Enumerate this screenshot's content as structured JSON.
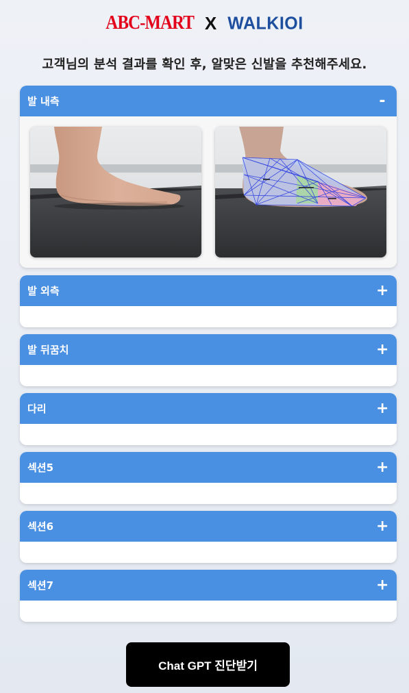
{
  "brand": {
    "abc_mart": "ABC-MART",
    "separator": "X",
    "walk": "WALKIOI"
  },
  "headline": "고객님의 분석 결과를 확인 후, 알맞은 신발을 추천해주세요.",
  "sections": [
    {
      "title": "발 내측",
      "toggle": "-",
      "expanded": true
    },
    {
      "title": "발 외측",
      "toggle": "+",
      "expanded": false
    },
    {
      "title": "발 뒤꿈치",
      "toggle": "+",
      "expanded": false
    },
    {
      "title": "다리",
      "toggle": "+",
      "expanded": false
    },
    {
      "title": "섹션5",
      "toggle": "+",
      "expanded": false
    },
    {
      "title": "섹션6",
      "toggle": "+",
      "expanded": false
    },
    {
      "title": "섹션7",
      "toggle": "+",
      "expanded": false
    }
  ],
  "images": [
    {
      "name": "foot-inner-photo"
    },
    {
      "name": "foot-inner-analysis-photo"
    }
  ],
  "cta_label": "Chat GPT 진단받기",
  "colors": {
    "header_blue": "#4a90e2",
    "abc_red": "#e3001b",
    "walk_blue": "#1d4f9e",
    "cta_black": "#000000"
  }
}
